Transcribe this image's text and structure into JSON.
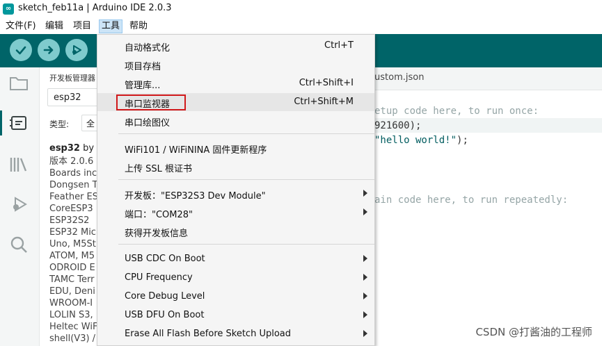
{
  "window": {
    "title": "sketch_feb11a | Arduino IDE 2.0.3",
    "icon": "arduino-infinity-icon"
  },
  "menubar": {
    "items": [
      "文件(F)",
      "编辑",
      "项目",
      "工具",
      "帮助"
    ],
    "active": "工具"
  },
  "toolbar": {
    "buttons": [
      "verify-icon",
      "upload-icon",
      "debug-icon"
    ]
  },
  "sidebar": {
    "icons": [
      "folder-icon",
      "board-manager-icon",
      "library-icon",
      "debug-icon",
      "search-icon"
    ],
    "active": "board-manager-icon"
  },
  "boards_panel": {
    "title": "开发板管理器",
    "search_value": "esp32",
    "type_label": "类型:",
    "type_value": "全",
    "board_name": "esp32",
    "board_by": " by E",
    "lines": [
      "版本 2.0.6",
      "Boards inc",
      "Dongsen T",
      "Feather ES",
      "CoreESP3",
      "ESP32S2",
      "ESP32 Mic",
      "Uno, M5St",
      "ATOM, M5",
      "ODROID E",
      "TAMC Terr",
      "EDU, Deni",
      "WROOM-I",
      "LOLIN S3,",
      "Heltec WiF",
      "shell(V3) /"
    ]
  },
  "editor": {
    "tab_label": "ustom.json",
    "code": {
      "line1": "etup code here, to run once:",
      "line2a": "921600);",
      "line3a": "\"hello world!\"",
      "line3b": ");",
      "line4": "ain code here, to run repeatedly:"
    }
  },
  "tools_menu": {
    "items": [
      {
        "label": "自动格式化",
        "shortcut": "Ctrl+T"
      },
      {
        "label": "项目存档",
        "shortcut": ""
      },
      {
        "label": "管理库...",
        "shortcut": "Ctrl+Shift+I"
      },
      {
        "label": "串口监视器",
        "shortcut": "Ctrl+Shift+M",
        "highlighted": true
      },
      {
        "label": "串口绘图仪",
        "shortcut": ""
      },
      {
        "label": "WiFi101 / WiFiNINA 固件更新程序",
        "shortcut": ""
      },
      {
        "label": "上传 SSL 根证书",
        "shortcut": ""
      },
      {
        "label": "开发板：\"ESP32S3 Dev Module\"",
        "submenu": true
      },
      {
        "label": "端口：\"COM28\"",
        "submenu": true
      },
      {
        "label": "获得开发板信息",
        "shortcut": ""
      },
      {
        "label": "USB CDC On Boot",
        "submenu": true
      },
      {
        "label": "CPU Frequency",
        "submenu": true
      },
      {
        "label": "Core Debug Level",
        "submenu": true
      },
      {
        "label": "USB DFU On Boot",
        "submenu": true
      },
      {
        "label": "Erase All Flash Before Sketch Upload",
        "submenu": true
      }
    ]
  },
  "watermark": "CSDN @打酱油的工程师",
  "colors": {
    "toolbar": "#006468",
    "toolbar_button": "#7fcbcd",
    "highlight_box": "#d0181a"
  }
}
